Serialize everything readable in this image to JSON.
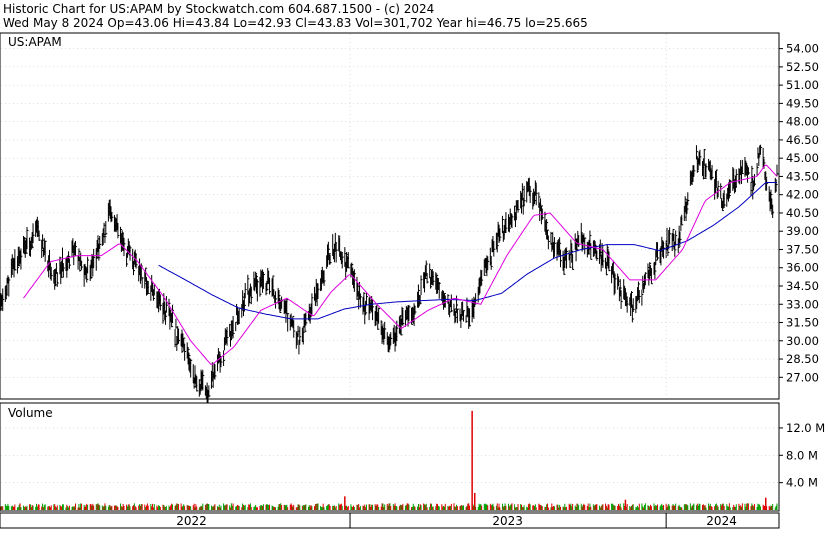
{
  "chart_data": {
    "type": "line",
    "header": {
      "line1": "Historic Chart for US:APAM by Stockwatch.com 604.687.1500 - (c) 2024",
      "line2": "Wed May  8 2024   Op=43.06  Hi=43.84  Lo=42.93  Cl=43.83  Vol=301,702  Year hi=46.75  lo=25.665"
    },
    "symbol_label": "US:APAM",
    "volume_label": "Volume",
    "price_axis": {
      "ylim": [
        25.3,
        55.2
      ],
      "ticks": [
        "54.00",
        "52.50",
        "51.00",
        "49.50",
        "48.00",
        "46.50",
        "45.00",
        "43.50",
        "42.00",
        "40.50",
        "39.00",
        "37.50",
        "36.00",
        "34.50",
        "33.00",
        "31.50",
        "30.00",
        "28.50",
        "27.00"
      ]
    },
    "volume_axis": {
      "ylim": [
        0,
        15.5
      ],
      "ticks": [
        "12.0 M",
        "8.0 M",
        "4.0 M"
      ]
    },
    "x_axis": {
      "start": "2021-11-24",
      "end": "2024-05-08",
      "years": [
        {
          "label": "2022",
          "start": "2022-01-01",
          "end": "2022-12-31"
        },
        {
          "label": "2023",
          "start": "2023-01-01",
          "end": "2023-12-31"
        },
        {
          "label": "2024",
          "start": "2024-01-01",
          "end": "2024-05-08"
        }
      ]
    },
    "price_anchors": [
      [
        "2021-11-24",
        32.8
      ],
      [
        "2021-12-10",
        36.5
      ],
      [
        "2022-01-05",
        39.0
      ],
      [
        "2022-01-25",
        35.0
      ],
      [
        "2022-02-15",
        37.5
      ],
      [
        "2022-03-01",
        35.5
      ],
      [
        "2022-03-20",
        38.0
      ],
      [
        "2022-03-30",
        40.5
      ],
      [
        "2022-04-15",
        37.5
      ],
      [
        "2022-05-05",
        35.5
      ],
      [
        "2022-05-25",
        33.5
      ],
      [
        "2022-06-10",
        31.5
      ],
      [
        "2022-06-25",
        29.0
      ],
      [
        "2022-07-10",
        26.3
      ],
      [
        "2022-07-20",
        26.0
      ],
      [
        "2022-08-05",
        28.5
      ],
      [
        "2022-08-20",
        31.5
      ],
      [
        "2022-09-05",
        34.0
      ],
      [
        "2022-09-25",
        35.0
      ],
      [
        "2022-10-10",
        33.5
      ],
      [
        "2022-10-25",
        31.5
      ],
      [
        "2022-11-05",
        30.0
      ],
      [
        "2022-11-20",
        33.5
      ],
      [
        "2022-12-05",
        36.5
      ],
      [
        "2022-12-15",
        38.0
      ],
      [
        "2022-12-30",
        36.0
      ],
      [
        "2023-01-15",
        33.0
      ],
      [
        "2023-02-01",
        32.5
      ],
      [
        "2023-02-15",
        29.5
      ],
      [
        "2023-03-01",
        31.5
      ],
      [
        "2023-03-15",
        32.5
      ],
      [
        "2023-04-01",
        35.5
      ],
      [
        "2023-04-15",
        34.0
      ],
      [
        "2023-05-01",
        32.5
      ],
      [
        "2023-05-20",
        32.0
      ],
      [
        "2023-06-01",
        35.0
      ],
      [
        "2023-06-20",
        38.5
      ],
      [
        "2023-07-10",
        40.0
      ],
      [
        "2023-07-25",
        42.5
      ],
      [
        "2023-08-05",
        42.0
      ],
      [
        "2023-08-20",
        38.0
      ],
      [
        "2023-09-10",
        36.5
      ],
      [
        "2023-09-25",
        38.5
      ],
      [
        "2023-10-10",
        37.5
      ],
      [
        "2023-10-25",
        36.5
      ],
      [
        "2023-11-10",
        34.0
      ],
      [
        "2023-11-25",
        32.5
      ],
      [
        "2023-12-10",
        35.5
      ],
      [
        "2023-12-28",
        37.5
      ],
      [
        "2024-01-15",
        38.5
      ],
      [
        "2024-01-25",
        41.5
      ],
      [
        "2024-02-05",
        45.0
      ],
      [
        "2024-02-20",
        44.0
      ],
      [
        "2024-03-05",
        41.5
      ],
      [
        "2024-03-20",
        43.0
      ],
      [
        "2024-04-01",
        44.5
      ],
      [
        "2024-04-10",
        43.0
      ],
      [
        "2024-04-20",
        46.0
      ],
      [
        "2024-04-28",
        42.0
      ],
      [
        "2024-05-03",
        41.0
      ],
      [
        "2024-05-08",
        43.8
      ]
    ],
    "ma_short": [
      [
        "2021-12-20",
        33.5
      ],
      [
        "2022-01-20",
        36.5
      ],
      [
        "2022-02-20",
        37.0
      ],
      [
        "2022-03-20",
        37.0
      ],
      [
        "2022-04-10",
        38.0
      ],
      [
        "2022-05-01",
        36.5
      ],
      [
        "2022-06-01",
        33.5
      ],
      [
        "2022-07-01",
        30.0
      ],
      [
        "2022-07-25",
        28.0
      ],
      [
        "2022-08-20",
        29.5
      ],
      [
        "2022-09-20",
        32.5
      ],
      [
        "2022-10-20",
        33.5
      ],
      [
        "2022-11-20",
        32.0
      ],
      [
        "2022-12-10",
        34.0
      ],
      [
        "2023-01-01",
        35.5
      ],
      [
        "2023-02-01",
        33.0
      ],
      [
        "2023-03-01",
        31.0
      ],
      [
        "2023-04-01",
        32.5
      ],
      [
        "2023-05-01",
        33.5
      ],
      [
        "2023-06-01",
        33.0
      ],
      [
        "2023-07-01",
        37.0
      ],
      [
        "2023-08-01",
        40.3
      ],
      [
        "2023-08-20",
        40.5
      ],
      [
        "2023-09-20",
        38.0
      ],
      [
        "2023-10-20",
        37.5
      ],
      [
        "2023-11-20",
        35.0
      ],
      [
        "2023-12-20",
        35.0
      ],
      [
        "2024-01-20",
        37.5
      ],
      [
        "2024-02-15",
        41.5
      ],
      [
        "2024-03-15",
        43.0
      ],
      [
        "2024-04-15",
        43.5
      ],
      [
        "2024-04-25",
        44.5
      ],
      [
        "2024-05-08",
        43.5
      ]
    ],
    "ma_long": [
      [
        "2022-05-25",
        36.2
      ],
      [
        "2022-06-25",
        35.0
      ],
      [
        "2022-07-25",
        33.8
      ],
      [
        "2022-08-25",
        32.7
      ],
      [
        "2022-09-25",
        32.2
      ],
      [
        "2022-10-25",
        31.8
      ],
      [
        "2022-11-25",
        31.8
      ],
      [
        "2022-12-25",
        32.6
      ],
      [
        "2023-01-25",
        33.0
      ],
      [
        "2023-02-25",
        33.2
      ],
      [
        "2023-03-25",
        33.3
      ],
      [
        "2023-04-25",
        33.4
      ],
      [
        "2023-05-25",
        33.3
      ],
      [
        "2023-06-25",
        33.9
      ],
      [
        "2023-07-25",
        35.5
      ],
      [
        "2023-08-25",
        36.8
      ],
      [
        "2023-09-25",
        37.5
      ],
      [
        "2023-10-25",
        37.9
      ],
      [
        "2023-11-25",
        37.9
      ],
      [
        "2023-12-25",
        37.4
      ],
      [
        "2024-01-25",
        38.2
      ],
      [
        "2024-02-25",
        39.5
      ],
      [
        "2024-03-25",
        41.0
      ],
      [
        "2024-04-25",
        43.0
      ],
      [
        "2024-05-08",
        43.0
      ]
    ],
    "volume_spikes": [
      [
        "2022-12-26",
        2.0
      ],
      [
        "2023-05-22",
        14.5
      ],
      [
        "2023-05-25",
        2.5
      ],
      [
        "2023-11-15",
        1.5
      ],
      [
        "2024-04-25",
        1.8
      ]
    ],
    "volume_typical": 0.9,
    "colors": {
      "price": "#000000",
      "ma_short": "#e000e0",
      "ma_long": "#0000c0",
      "volume_up": "#00a000",
      "volume_down": "#e00000",
      "frame": "#000000",
      "grid": "#c0c0c0"
    }
  }
}
